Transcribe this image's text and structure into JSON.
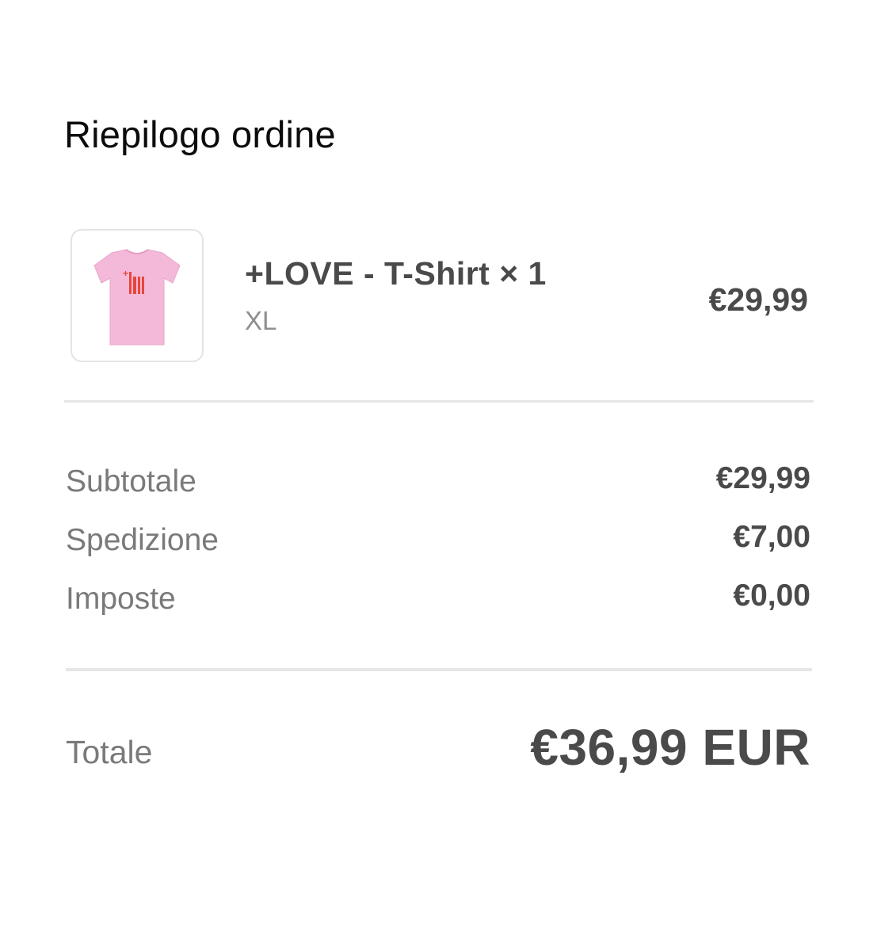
{
  "header": {
    "title": "Riepilogo ordine"
  },
  "item": {
    "name": "+LOVE - T-Shirt × 1",
    "variant": "XL",
    "price": "€29,99",
    "thumbnail_icon": "pink-tshirt-image",
    "thumbnail_print": "+LOVE",
    "colors": {
      "shirt": "#f4b9d9",
      "print": "#e8463a"
    }
  },
  "summary": {
    "rows": [
      {
        "label": "Subtotale",
        "value": "€29,99"
      },
      {
        "label": "Spedizione",
        "value": "€7,00"
      },
      {
        "label": "Imposte",
        "value": "€0,00"
      }
    ]
  },
  "total": {
    "label": "Totale",
    "value": "€36,99 EUR"
  },
  "colors": {
    "text_primary": "#4a4a4a",
    "text_muted": "#7a7a7a",
    "divider": "#e6e6e6"
  }
}
